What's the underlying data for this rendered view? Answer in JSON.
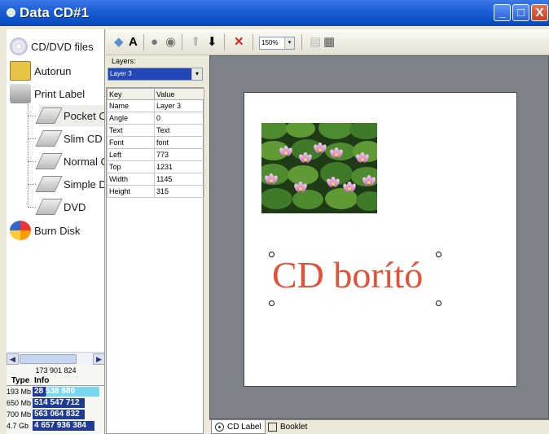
{
  "window": {
    "title": "Data CD#1",
    "minimize": "_",
    "maximize": "□",
    "close": "X"
  },
  "sidebar": {
    "items": [
      {
        "label": "CD/DVD files",
        "icon": "cd-icon"
      },
      {
        "label": "Autorun",
        "icon": "autorun-icon"
      },
      {
        "label": "Print Label",
        "icon": "printer-icon"
      }
    ],
    "subitems": [
      {
        "label": "Pocket C"
      },
      {
        "label": "Slim CD"
      },
      {
        "label": "Normal C"
      },
      {
        "label": "Simple D"
      },
      {
        "label": "DVD"
      }
    ],
    "burn": {
      "label": "Burn Disk",
      "icon": "burn-disk-icon"
    }
  },
  "capacity": {
    "total": "173 901 824",
    "headers": [
      "Type",
      "Info"
    ],
    "rows": [
      {
        "type": "193 Mb",
        "info": "28 538 880",
        "fill": 0.2
      },
      {
        "type": "650 Mb",
        "info": "514 547 712",
        "fill": 1.0
      },
      {
        "type": "700 Mb",
        "info": "563 064 832",
        "fill": 1.0
      },
      {
        "type": "4.7 Gb",
        "info": "4 657 936 384",
        "fill": 1.0
      }
    ]
  },
  "toolbar": {
    "text_tool": "A",
    "zoom": "150%",
    "zoom_arrow": "▾"
  },
  "layers": {
    "label": "Layers:",
    "selected": "Layer 3",
    "arrow": "▾",
    "grid_headers": [
      "Key",
      "Value"
    ],
    "grid_rows": [
      [
        "Name",
        "Layer 3"
      ],
      [
        "Angle",
        "0"
      ],
      [
        "Text",
        "Text"
      ],
      [
        "Font",
        "font"
      ],
      [
        "Left",
        "773"
      ],
      [
        "Top",
        "1231"
      ],
      [
        "Width",
        "1145"
      ],
      [
        "Height",
        "315"
      ]
    ]
  },
  "canvas": {
    "text": "CD borító",
    "text_color": "#e0533a"
  },
  "tabs": [
    {
      "label": "CD Label"
    },
    {
      "label": "Booklet"
    }
  ]
}
